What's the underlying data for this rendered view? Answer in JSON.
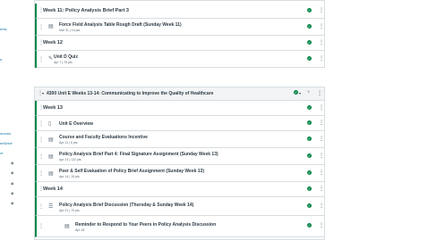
{
  "leftnav": {
    "links": [
      "ents",
      "s",
      "ources",
      "neDrive",
      "ct"
    ]
  },
  "module1": {
    "rows": [
      {
        "kind": "header",
        "title": "Week 11: Policy Analysis Brief Part 3"
      },
      {
        "kind": "item",
        "icon": "assignment-icon",
        "title": "Force Field Analysis Table Rough Draft (Sunday Week 11)",
        "meta": "Mar 31  |  16 pts"
      },
      {
        "kind": "header",
        "title": "Week 12"
      },
      {
        "kind": "item",
        "icon": "quiz-icon",
        "title": "Unit D Quiz",
        "meta": "Apr 7  |  75 pts"
      }
    ]
  },
  "module2": {
    "title": "4300 Unit E Weeks 13-14: Communicating to Improve the Quality of Healthcare",
    "rows": [
      {
        "kind": "header",
        "title": "Week 13"
      },
      {
        "kind": "item",
        "icon": "page-icon",
        "title": "Unit E Overview",
        "meta": ""
      },
      {
        "kind": "item",
        "icon": "assignment-icon",
        "title": "Course and Faculty Evaluations Incentive",
        "meta": "Apr 11  |  5 pts"
      },
      {
        "kind": "item",
        "icon": "assignment-icon",
        "title": "Policy Analysis Brief Part 4: Final Signature Assignment (Sunday Week 13)",
        "meta": "Apr 14  |  122 pts"
      },
      {
        "kind": "item",
        "icon": "assignment-icon",
        "title": "Peer & Self Evaluation of Policy Brief Assignment (Sunday Week 13)",
        "meta": "Apr 14  |  15 pts"
      },
      {
        "kind": "header",
        "title": "Week 14"
      },
      {
        "kind": "item",
        "icon": "discussion-icon",
        "title": "Policy Analysis Brief Discussion (Thursday & Sunday Week 14)",
        "meta": "Apr 21  |  75 pts"
      },
      {
        "kind": "item",
        "icon": "assignment-icon",
        "title": "Reminder to Respond to Your Peers in Policy Analysis Discussion",
        "meta": "Apr 18"
      }
    ]
  }
}
